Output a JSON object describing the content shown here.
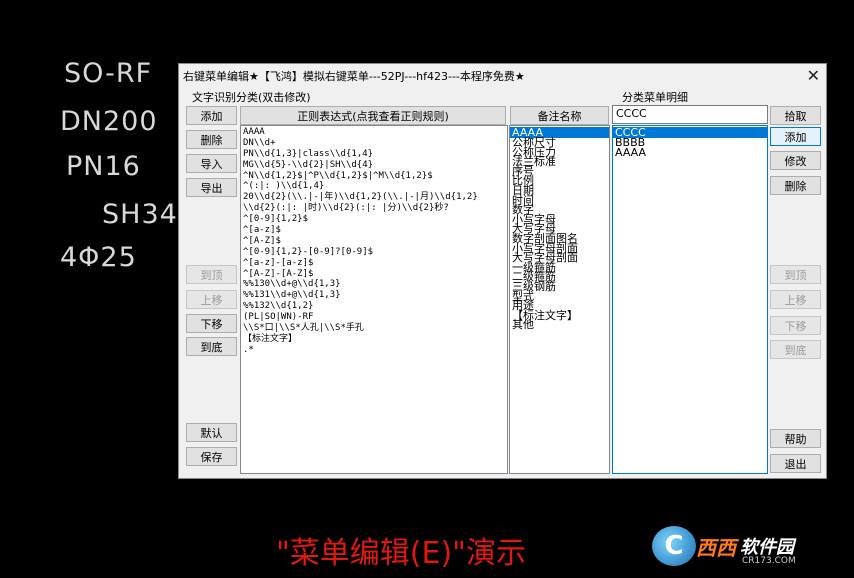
{
  "cad_labels": {
    "so_rf": "SO-RF",
    "dn": "DN200",
    "pn": "PN16",
    "sh": "SH340",
    "count": "4Φ25"
  },
  "dialog": {
    "title": "右键菜单编辑★【飞鸿】模拟右键菜单---52PJ---hf423---本程序免费★",
    "left_group_label": "文字识别分类(双击修改)",
    "right_group_label": "分类菜单明细",
    "left_buttons": {
      "add": "添加",
      "delete": "删除",
      "import": "导入",
      "export": "导出",
      "top": "到顶",
      "up": "上移",
      "down": "下移",
      "bottom": "到底",
      "default": "默认",
      "save": "保存"
    },
    "regex_header": "正则表达式(点我查看正则规则)",
    "notes_header": "备注名称",
    "regex_items": [
      "AAAA",
      "DN\\\\d+",
      "PN\\\\d{1,3}|class\\\\d{1,4}",
      "MG\\\\d{5}-\\\\d{2}|SH\\\\d{4}",
      "^N\\\\d{1,2}$|^P\\\\d{1,2}$|^M\\\\d{1,2}$",
      "^(:|: )\\\\d{1,4}",
      "20\\\\d{2}(\\\\.|-|年)\\\\d{1,2}(\\\\.|-|月)\\\\d{1,2}",
      "\\\\d{2}(:|: |时)\\\\d{2}(:|: |分)\\\\d{2}秒?",
      "^[0-9]{1,2}$",
      "^[a-z]$",
      "^[A-Z]$",
      "^[0-9]{1,2}-[0-9]?[0-9]$",
      "^[a-z]-[a-z]$",
      "^[A-Z]-[A-Z]$",
      "%%130\\\\d+@\\\\d{1,3}",
      "%%131\\\\d+@\\\\d{1,3}",
      "%%132\\\\d{1,2}",
      "(PL|SO|WN)-RF",
      "\\\\S*口|\\\\S*人孔|\\\\S*手孔",
      "【标注文字】",
      ".*"
    ],
    "notes_items": [
      "AAAA",
      "公称尺寸",
      "公称压力",
      "法兰标准",
      "序号",
      "比例",
      "日期",
      "时间",
      "数字",
      "小写字母",
      "大写字母",
      "数字剖面图名",
      "小写字母剖面",
      "大写字母剖面",
      "一级箍筋",
      "二级箍筋",
      "三级钢筋",
      "型式",
      "用途",
      "【标注文字】",
      "其他"
    ],
    "menu_input_value": "CCCC",
    "menu_items": [
      "CCCC",
      "BBBB",
      "AAAA"
    ],
    "right_buttons": {
      "pick": "拾取",
      "add": "添加",
      "modify": "修改",
      "delete": "删除",
      "top": "到顶",
      "up": "上移",
      "down": "下移",
      "bottom": "到底",
      "help": "帮助",
      "exit": "退出"
    },
    "close_glyph": "✕"
  },
  "caption": "\"菜单编辑(E)\"演示",
  "watermark": {
    "logo_letter": "C",
    "brand": "西西",
    "name": "软件园",
    "url": "CR173.COM"
  },
  "colors": {
    "selection": "#0078d7",
    "caption": "#e0190f",
    "background": "#000000",
    "dialog": "#f0f0f0"
  }
}
